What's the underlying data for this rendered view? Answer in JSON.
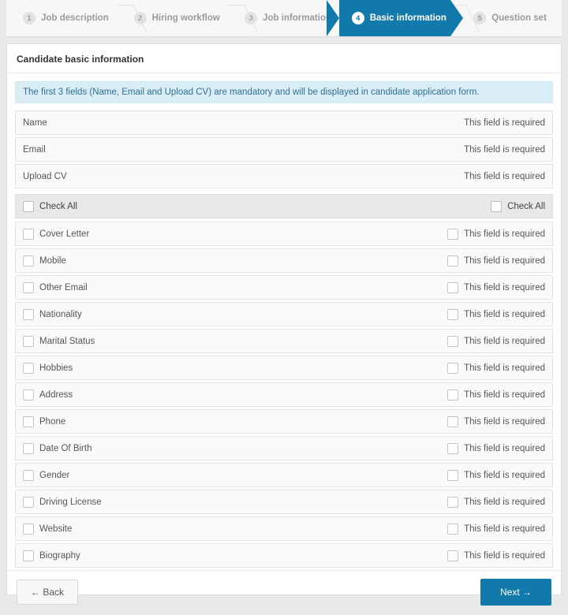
{
  "stepper": {
    "steps": [
      {
        "num": "1",
        "label": "Job description",
        "active": false
      },
      {
        "num": "2",
        "label": "Hiring workflow",
        "active": false
      },
      {
        "num": "3",
        "label": "Job information",
        "active": false
      },
      {
        "num": "4",
        "label": "Basic information",
        "active": true
      },
      {
        "num": "5",
        "label": "Question set",
        "active": false
      }
    ],
    "active_color": "#1279ab"
  },
  "card": {
    "title": "Candidate basic information",
    "alert": "The first 3 fields (Name, Email and Upload CV) are mandatory and will be displayed in candidate application form.",
    "required_text": "This field is required",
    "mandatory_fields": [
      {
        "label": "Name",
        "required_text": "This field is required"
      },
      {
        "label": "Email",
        "required_text": "This field is required"
      },
      {
        "label": "Upload CV",
        "required_text": "This field is required"
      }
    ],
    "check_all": {
      "left_label": "Check All",
      "right_label": "Check All",
      "left_checked": false,
      "right_checked": false
    },
    "optional_fields": [
      {
        "label": "Cover Letter",
        "enabled": false,
        "required": false,
        "required_text": "This field is required"
      },
      {
        "label": "Mobile",
        "enabled": false,
        "required": false,
        "required_text": "This field is required"
      },
      {
        "label": "Other Email",
        "enabled": false,
        "required": false,
        "required_text": "This field is required"
      },
      {
        "label": "Nationality",
        "enabled": false,
        "required": false,
        "required_text": "This field is required"
      },
      {
        "label": "Marital Status",
        "enabled": false,
        "required": false,
        "required_text": "This field is required"
      },
      {
        "label": "Hobbies",
        "enabled": false,
        "required": false,
        "required_text": "This field is required"
      },
      {
        "label": "Address",
        "enabled": false,
        "required": false,
        "required_text": "This field is required"
      },
      {
        "label": "Phone",
        "enabled": false,
        "required": false,
        "required_text": "This field is required"
      },
      {
        "label": "Date Of Birth",
        "enabled": false,
        "required": false,
        "required_text": "This field is required"
      },
      {
        "label": "Gender",
        "enabled": false,
        "required": false,
        "required_text": "This field is required"
      },
      {
        "label": "Driving License",
        "enabled": false,
        "required": false,
        "required_text": "This field is required"
      },
      {
        "label": "Website",
        "enabled": false,
        "required": false,
        "required_text": "This field is required"
      },
      {
        "label": "Biography",
        "enabled": false,
        "required": false,
        "required_text": "This field is required"
      }
    ],
    "footer": {
      "back_label": "← Back",
      "next_label": "Next →"
    }
  }
}
